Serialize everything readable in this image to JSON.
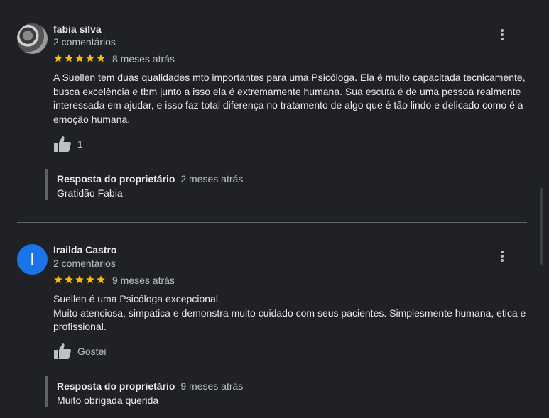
{
  "reviews": [
    {
      "name": "fabia silva",
      "count": "2 comentários",
      "rating": 5,
      "ago": "8 meses atrás",
      "text": "A Suellen tem duas qualidades mto importantes para uma Psicóloga. Ela é muito capacitada tecnicamente, busca excelência e tbm junto a isso ela é extremamente humana. Sua escuta é de uma pessoa realmente interessada em ajudar, e isso faz total diferença no tratamento de algo que é tão lindo e delicado como é a emoção humana.",
      "like_label": "1",
      "reply": {
        "owner_label": "Resposta do proprietário",
        "ago": "2 meses atrás",
        "text": "Gratidão Fabia"
      }
    },
    {
      "name": "Irailda Castro",
      "avatar_letter": "I",
      "count": "2 comentários",
      "rating": 5,
      "ago": "9 meses atrás",
      "text_line1": "Suellen é uma Psicóloga excepcional.",
      "text_line2": "Muito atenciosa, simpatica e demonstra muito cuidado com seus pacientes. Simplesmente humana, etica e profissional.",
      "like_label": "Gostei",
      "reply": {
        "owner_label": "Resposta do proprietário",
        "ago": "9 meses atrás",
        "text": "Muito obrigada querida"
      }
    }
  ],
  "colors": {
    "background": "#202124",
    "star": "#fbbc04",
    "avatar_blue": "#1a73e8"
  },
  "icons": [
    "more-vert-icon",
    "star-icon",
    "thumb-up-icon"
  ]
}
